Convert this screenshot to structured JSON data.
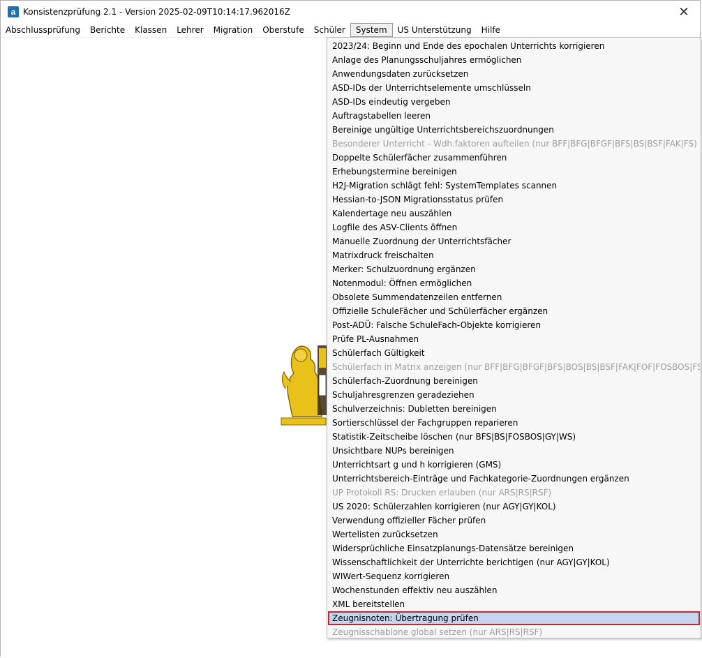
{
  "window": {
    "title": "Konsistenzprüfung 2.1 - Version 2025-02-09T10:14:17.962016Z",
    "app_icon_letter": "a",
    "close_glyph": "✕"
  },
  "menubar": {
    "items": [
      {
        "label": "Abschlussprüfung"
      },
      {
        "label": "Berichte"
      },
      {
        "label": "Klassen"
      },
      {
        "label": "Lehrer"
      },
      {
        "label": "Migration"
      },
      {
        "label": "Oberstufe"
      },
      {
        "label": "Schüler"
      },
      {
        "label": "System",
        "active": true
      },
      {
        "label": "US Unterstützung"
      },
      {
        "label": "Hilfe"
      }
    ]
  },
  "system_menu": {
    "items": [
      {
        "label": "2023/24: Beginn und Ende des epochalen Unterrichts korrigieren",
        "enabled": true
      },
      {
        "label": "Anlage des Planungsschuljahres ermöglichen",
        "enabled": true
      },
      {
        "label": "Anwendungsdaten zurücksetzen",
        "enabled": true
      },
      {
        "label": "ASD-IDs der Unterrichtselemente umschlüsseln",
        "enabled": true
      },
      {
        "label": "ASD-IDs eindeutig vergeben",
        "enabled": true
      },
      {
        "label": "Auftragstabellen leeren",
        "enabled": true
      },
      {
        "label": "Bereinige ungültige Unterrichtsbereichszuordnungen",
        "enabled": true
      },
      {
        "label": "Besonderer Unterricht - Wdh.faktoren aufteilen (nur BFF|BFG|BFGF|BFS|BS|BSF|FAK|FS)",
        "enabled": false
      },
      {
        "label": "Doppelte Schülerfächer zusammenführen",
        "enabled": true
      },
      {
        "label": "Erhebungstermine bereinigen",
        "enabled": true
      },
      {
        "label": "H2J-Migration schlägt fehl: SystemTemplates scannen",
        "enabled": true
      },
      {
        "label": "Hessian-to-JSON Migrationsstatus prüfen",
        "enabled": true
      },
      {
        "label": "Kalendertage neu auszählen",
        "enabled": true
      },
      {
        "label": "Logfile des ASV-Clients öffnen",
        "enabled": true
      },
      {
        "label": "Manuelle Zuordnung der Unterrichtsfächer",
        "enabled": true
      },
      {
        "label": "Matrixdruck freischalten",
        "enabled": true
      },
      {
        "label": "Merker: Schulzuordnung ergänzen",
        "enabled": true
      },
      {
        "label": "Notenmodul: Öffnen ermöglichen",
        "enabled": true
      },
      {
        "label": "Obsolete Summendatenzeilen entfernen",
        "enabled": true
      },
      {
        "label": "Offizielle SchuleFächer und Schülerfächer ergänzen",
        "enabled": true
      },
      {
        "label": "Post-ADÜ: Falsche SchuleFach-Objekte korrigieren",
        "enabled": true
      },
      {
        "label": "Prüfe PL-Ausnahmen",
        "enabled": true
      },
      {
        "label": "Schülerfach Gültigkeit",
        "enabled": true
      },
      {
        "label": "Schülerfach in Matrix anzeigen (nur BFF|BFG|BFGF|BFS|BOS|BS|BSF|FAK|FOF|FOSBOS|FS|WS|WSF)",
        "enabled": false
      },
      {
        "label": "Schülerfach-Zuordnung bereinigen",
        "enabled": true
      },
      {
        "label": "Schuljahresgrenzen geradeziehen",
        "enabled": true
      },
      {
        "label": "Schulverzeichnis: Dubletten bereinigen",
        "enabled": true
      },
      {
        "label": "Sortierschlüssel der Fachgruppen reparieren",
        "enabled": true
      },
      {
        "label": "Statistik-Zeitscheibe löschen (nur BFS|BS|FOSBOS|GY|WS)",
        "enabled": true
      },
      {
        "label": "Unsichtbare NUPs bereinigen",
        "enabled": true
      },
      {
        "label": "Unterrichtsart g und h korrigieren (GMS)",
        "enabled": true
      },
      {
        "label": "Unterrichtsbereich-Einträge und Fachkategorie-Zuordnungen ergänzen",
        "enabled": true
      },
      {
        "label": "UP Protokoll RS: Drucken erlauben (nur ARS|RS|RSF)",
        "enabled": false
      },
      {
        "label": "US 2020: Schülerzahlen korrigieren (nur AGY|GY|KOL)",
        "enabled": true
      },
      {
        "label": "Verwendung offizieller Fächer prüfen",
        "enabled": true
      },
      {
        "label": "Wertelisten zurücksetzen",
        "enabled": true
      },
      {
        "label": "Widersprüchliche Einsatzplanungs-Datensätze bereinigen",
        "enabled": true
      },
      {
        "label": "Wissenschaftlichkeit der Unterrichte berichtigen (nur AGY|GY|KOL)",
        "enabled": true
      },
      {
        "label": "WIWert-Sequenz korrigieren",
        "enabled": true
      },
      {
        "label": "Wochenstunden effektiv neu auszählen",
        "enabled": true
      },
      {
        "label": "XML bereitstellen",
        "enabled": true
      },
      {
        "label": "Zeugnisnoten: Übertragung prüfen",
        "enabled": true,
        "highlighted": true
      },
      {
        "label": "Zeugnisschablone global setzen (nur ARS|RS|RSF)",
        "enabled": false
      }
    ]
  },
  "colors": {
    "highlight_bg": "#c5d5ee",
    "highlight_border": "#c1272d",
    "disabled_text": "#9e9e9e",
    "emblem_gold": "#e8c21b"
  }
}
